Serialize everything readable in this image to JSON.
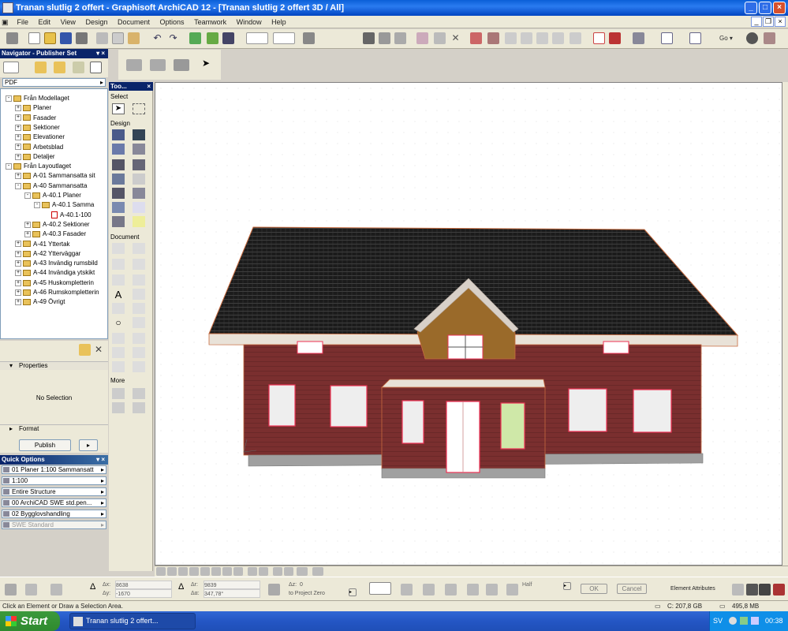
{
  "window": {
    "title": "Tranan slutlig 2 offert  - Graphisoft ArchiCAD 12 - [Tranan slutlig 2 offert  3D / All]"
  },
  "menu": [
    "File",
    "Edit",
    "View",
    "Design",
    "Document",
    "Options",
    "Teamwork",
    "Window",
    "Help"
  ],
  "navigator": {
    "header": "Navigator - Publisher Set",
    "format": "PDF",
    "tree": [
      {
        "label": "Från Modellaget",
        "level": 0,
        "pm": "-",
        "type": "root"
      },
      {
        "label": "Planer",
        "level": 1,
        "pm": "+",
        "type": "folder"
      },
      {
        "label": "Fasader",
        "level": 1,
        "pm": "+",
        "type": "folder"
      },
      {
        "label": "Sektioner",
        "level": 1,
        "pm": "+",
        "type": "folder"
      },
      {
        "label": "Elevationer",
        "level": 1,
        "pm": "+",
        "type": "folder"
      },
      {
        "label": "Arbetsblad",
        "level": 1,
        "pm": "+",
        "type": "folder"
      },
      {
        "label": "Detaljer",
        "level": 1,
        "pm": "+",
        "type": "folder"
      },
      {
        "label": "Från Layoutlaget",
        "level": 0,
        "pm": "-",
        "type": "root"
      },
      {
        "label": "A-01 Sammansatta sit",
        "level": 1,
        "pm": "+",
        "type": "folder"
      },
      {
        "label": "A-40 Sammansatta",
        "level": 1,
        "pm": "-",
        "type": "folder"
      },
      {
        "label": "A-40.1 Planer",
        "level": 2,
        "pm": "-",
        "type": "folder"
      },
      {
        "label": "A-40.1 Samma",
        "level": 3,
        "pm": "-",
        "type": "folder"
      },
      {
        "label": "A-40.1-100",
        "level": 4,
        "pm": "",
        "type": "pdf"
      },
      {
        "label": "A-40.2 Sektioner",
        "level": 2,
        "pm": "+",
        "type": "folder"
      },
      {
        "label": "A-40.3 Fasader",
        "level": 2,
        "pm": "+",
        "type": "folder"
      },
      {
        "label": "A-41 Yttertak",
        "level": 1,
        "pm": "+",
        "type": "folder"
      },
      {
        "label": "A-42 Ytterväggar",
        "level": 1,
        "pm": "+",
        "type": "folder"
      },
      {
        "label": "A-43 Invändig rumsbild",
        "level": 1,
        "pm": "+",
        "type": "folder"
      },
      {
        "label": "A-44 Invändiga ytskikt",
        "level": 1,
        "pm": "+",
        "type": "folder"
      },
      {
        "label": "A-45 Huskompletterin",
        "level": 1,
        "pm": "+",
        "type": "folder"
      },
      {
        "label": "A-46 Rumskompletterin",
        "level": 1,
        "pm": "+",
        "type": "folder"
      },
      {
        "label": "A-49 Övrigt",
        "level": 1,
        "pm": "+",
        "type": "folder"
      }
    ],
    "properties_label": "Properties",
    "no_selection": "No Selection",
    "format_label": "Format",
    "publish_label": "Publish"
  },
  "quick_options": {
    "header": "Quick Options",
    "rows": [
      {
        "label": "01 Planer 1:100 Sammansatt",
        "disabled": false
      },
      {
        "label": "1:100",
        "disabled": false
      },
      {
        "label": "Entire Structure",
        "disabled": false
      },
      {
        "label": "00 ArchiCAD SWE std.pen...",
        "disabled": false
      },
      {
        "label": "02 Bygglovshandling",
        "disabled": false
      },
      {
        "label": "SWE Standard",
        "disabled": true
      }
    ]
  },
  "toolbox": {
    "header": "Too...",
    "sections": [
      "Select",
      "Design",
      "Document",
      "More"
    ]
  },
  "info": {
    "ax": "8638",
    "ay": "-1670",
    "ax2": "9839",
    "aangle": "347,78°",
    "az": "0",
    "to_project_zero": "to Project Zero",
    "half": "Half",
    "ok": "OK",
    "cancel": "Cancel",
    "element_attributes": "Element Attributes",
    "ax_label": "Δx:",
    "ay_label": "Δy:",
    "az_label": "Δz:",
    "ar_label": "Δr:",
    "aa_label": "Δα:"
  },
  "status": {
    "message": "Click an Element or Draw a Selection Area.",
    "disk": "C: 207,8 GB",
    "memory": "495,8 MB"
  },
  "taskbar": {
    "start": "Start",
    "item": "Tranan slutlig 2 offert...",
    "lang": "SV",
    "clock": "00:38"
  }
}
